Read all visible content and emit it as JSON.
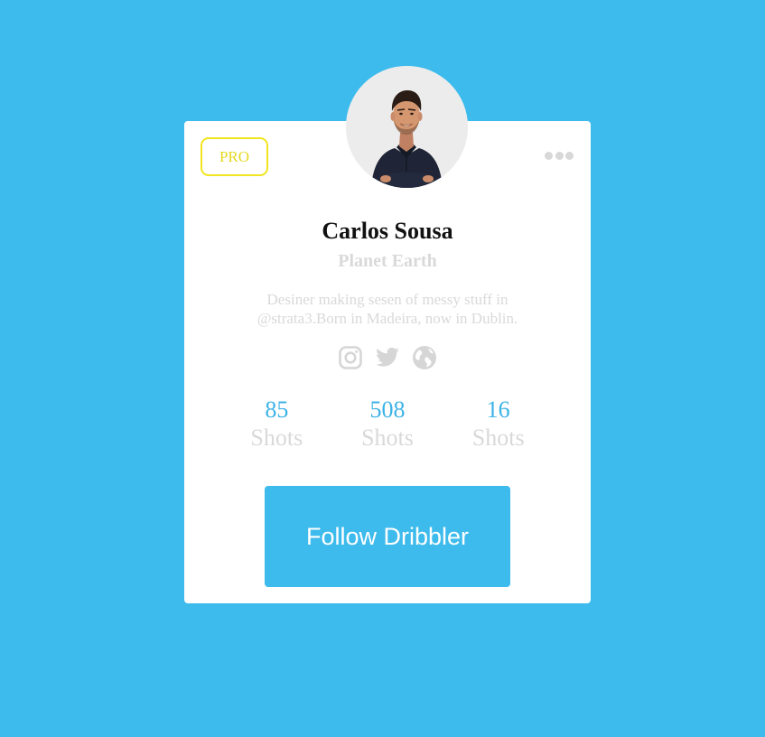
{
  "colors": {
    "background": "#3dbbec",
    "card": "#ffffff",
    "pro_border": "#f2e51f",
    "accent": "#3db3e6",
    "muted_text": "#d9d9d9",
    "button": "#3dbbec"
  },
  "card": {
    "badge": "PRO",
    "menu_icon": "more-dots-icon"
  },
  "profile": {
    "avatar_icon": "avatar",
    "name": "Carlos Sousa",
    "location": "Planet Earth",
    "bio": "Desiner making sesen of messy stuff in @strata3.Born in Madeira, now in Dublin."
  },
  "socials": [
    {
      "icon": "instagram-icon"
    },
    {
      "icon": "twitter-icon"
    },
    {
      "icon": "globe-icon"
    }
  ],
  "stats": [
    {
      "value": "85",
      "label": "Shots"
    },
    {
      "value": "508",
      "label": "Shots"
    },
    {
      "value": "16",
      "label": "Shots"
    }
  ],
  "follow_button": {
    "label": "Follow Dribbler"
  }
}
